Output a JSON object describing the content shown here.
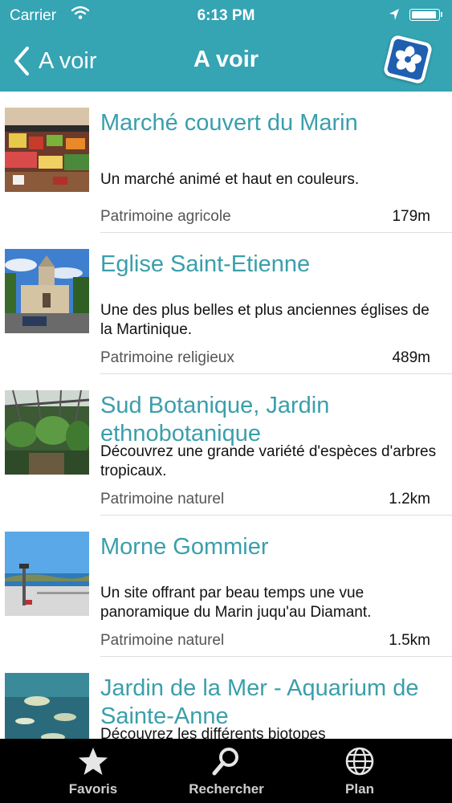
{
  "status": {
    "carrier": "Carrier",
    "time": "6:13 PM"
  },
  "nav": {
    "back_label": "A voir",
    "title": "A voir"
  },
  "items": [
    {
      "title": "Marché couvert du Marin",
      "description": "Un marché animé et haut en couleurs.",
      "category": "Patrimoine agricole",
      "distance": "179m"
    },
    {
      "title": "Eglise Saint-Etienne",
      "description": "Une des plus belles et plus anciennes églises de la Martinique.",
      "category": "Patrimoine religieux",
      "distance": "489m"
    },
    {
      "title": "Sud Botanique, Jardin ethnobotanique",
      "description": "Découvrez une grande variété d'espèces d'arbres tropicaux.",
      "category": "Patrimoine naturel",
      "distance": "1.2km"
    },
    {
      "title": "Morne Gommier",
      "description": "Un site offrant par beau temps une vue panoramique du Marin juqu'au Diamant.",
      "category": "Patrimoine naturel",
      "distance": "1.5km"
    },
    {
      "title": "Jardin de la Mer - Aquarium de Sainte-Anne",
      "description": "Découvrez les différents biotopes",
      "category": "",
      "distance": ""
    }
  ],
  "tabs": [
    {
      "label": "Favoris",
      "icon": "star-icon"
    },
    {
      "label": "Rechercher",
      "icon": "search-icon"
    },
    {
      "label": "Plan",
      "icon": "globe-icon"
    }
  ],
  "colors": {
    "header": "#35a4b3",
    "title_text": "#3a9fab",
    "tabbar": "#000000"
  }
}
